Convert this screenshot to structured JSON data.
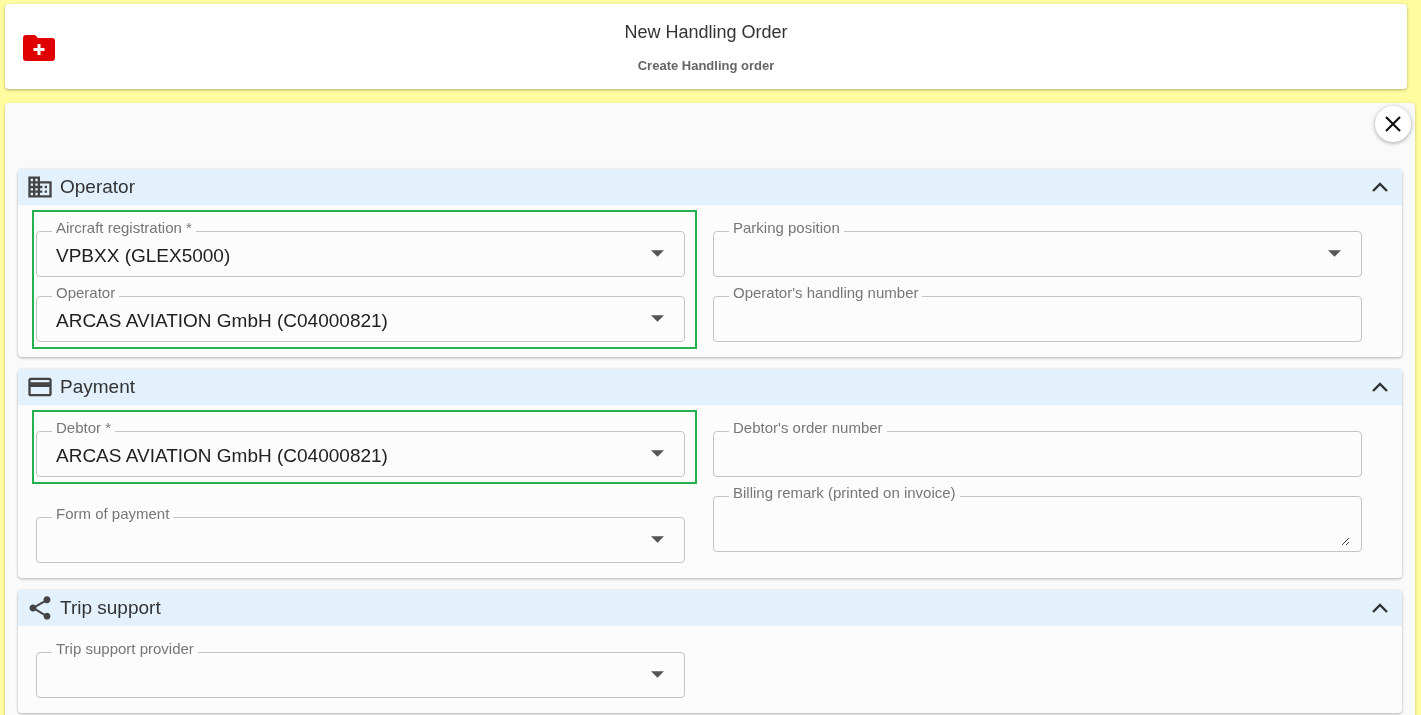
{
  "header": {
    "title": "New Handling Order",
    "subtitle": "Create Handling order"
  },
  "sections": [
    {
      "title": "Operator",
      "expanded": true,
      "columns": [
        [
          {
            "highlighted": true,
            "fields": [
              {
                "kind": "select",
                "label": "Aircraft registration *",
                "value": "VPBXX (GLEX5000)"
              },
              {
                "kind": "select",
                "label": "Operator",
                "value": "ARCAS AVIATION GmbH (C04000821)"
              }
            ]
          }
        ],
        [
          {
            "highlighted": false,
            "fields": [
              {
                "kind": "select",
                "label": "Parking position"
              },
              {
                "kind": "text",
                "label": "Operator's handling number"
              }
            ]
          }
        ]
      ]
    },
    {
      "title": "Payment",
      "expanded": true,
      "columns": [
        [
          {
            "highlighted": true,
            "fields": [
              {
                "kind": "select",
                "label": "Debtor *",
                "value": "ARCAS AVIATION GmbH (C04000821)"
              }
            ]
          },
          {
            "highlighted": false,
            "fields": [
              {
                "kind": "select",
                "label": "Form of payment"
              }
            ]
          }
        ],
        [
          {
            "highlighted": false,
            "fields": [
              {
                "kind": "text",
                "label": "Debtor's order number"
              },
              {
                "kind": "textarea",
                "label": "Billing remark (printed on invoice)"
              }
            ]
          }
        ]
      ]
    },
    {
      "title": "Trip support",
      "expanded": true,
      "columns": [
        [
          {
            "highlighted": false,
            "fields": [
              {
                "kind": "select",
                "label": "Trip support provider"
              }
            ]
          }
        ],
        []
      ]
    }
  ]
}
